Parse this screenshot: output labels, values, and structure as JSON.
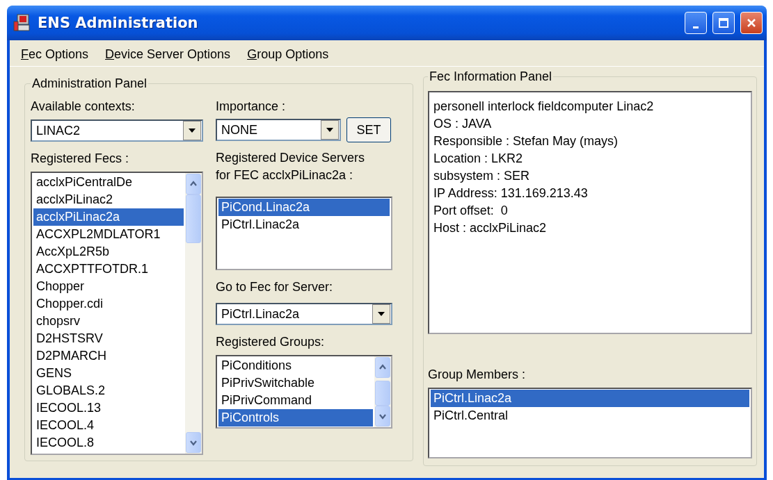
{
  "window": {
    "title": "ENS Administration"
  },
  "menu": [
    {
      "label": "Fec Options"
    },
    {
      "label": "Device Server Options"
    },
    {
      "label": "Group Options"
    }
  ],
  "admin_panel": {
    "title": "Administration Panel",
    "contexts": {
      "label": "Available contexts:",
      "value": "LINAC2"
    },
    "importance": {
      "label": "Importance :",
      "value": "NONE"
    },
    "set_button": "SET",
    "registered_fecs": {
      "label": "Registered Fecs :",
      "items": [
        {
          "label": "acclxPiCentralDe",
          "selected": false
        },
        {
          "label": "acclxPiLinac2",
          "selected": false
        },
        {
          "label": "acclxPiLinac2a",
          "selected": true
        },
        {
          "label": "ACCXPL2MDLATOR1",
          "selected": false
        },
        {
          "label": "AccXpL2R5b",
          "selected": false
        },
        {
          "label": "ACCXPTTFOTDR.1",
          "selected": false
        },
        {
          "label": "Chopper",
          "selected": false
        },
        {
          "label": "Chopper.cdi",
          "selected": false
        },
        {
          "label": "chopsrv",
          "selected": false
        },
        {
          "label": "D2HSTSRV",
          "selected": false
        },
        {
          "label": "D2PMARCH",
          "selected": false
        },
        {
          "label": "GENS",
          "selected": false
        },
        {
          "label": "GLOBALS.2",
          "selected": false
        },
        {
          "label": "IECOOL.13",
          "selected": false
        },
        {
          "label": "IECOOL.4",
          "selected": false
        },
        {
          "label": "IECOOL.8",
          "selected": false
        }
      ]
    },
    "device_servers": {
      "label": "Registered Device Servers\nfor FEC acclxPiLinac2a :",
      "items": [
        {
          "label": "PiCond.Linac2a",
          "selected": true
        },
        {
          "label": "PiCtrl.Linac2a",
          "selected": false
        }
      ]
    },
    "go_to_fec": {
      "label": "Go to Fec for Server:",
      "value": "PiCtrl.Linac2a"
    },
    "registered_groups": {
      "label": "Registered Groups:",
      "items": [
        {
          "label": "PiConditions",
          "selected": false
        },
        {
          "label": "PiPrivSwitchable",
          "selected": false
        },
        {
          "label": "PiPrivCommand",
          "selected": false
        },
        {
          "label": "PiControls",
          "selected": true
        }
      ]
    }
  },
  "info_panel": {
    "title": "Fec Information Panel",
    "lines": [
      "personell interlock fieldcomputer Linac2",
      "OS : JAVA",
      "Responsible : Stefan May (mays)",
      "Location : LKR2",
      "subsystem : SER",
      "IP Address: 131.169.213.43",
      "Port offset:  0",
      "Host : acclxPiLinac2"
    ],
    "group_members": {
      "label": "Group Members :",
      "items": [
        {
          "label": "PiCtrl.Linac2a",
          "selected": true
        },
        {
          "label": "PiCtrl.Central",
          "selected": false
        }
      ]
    }
  }
}
